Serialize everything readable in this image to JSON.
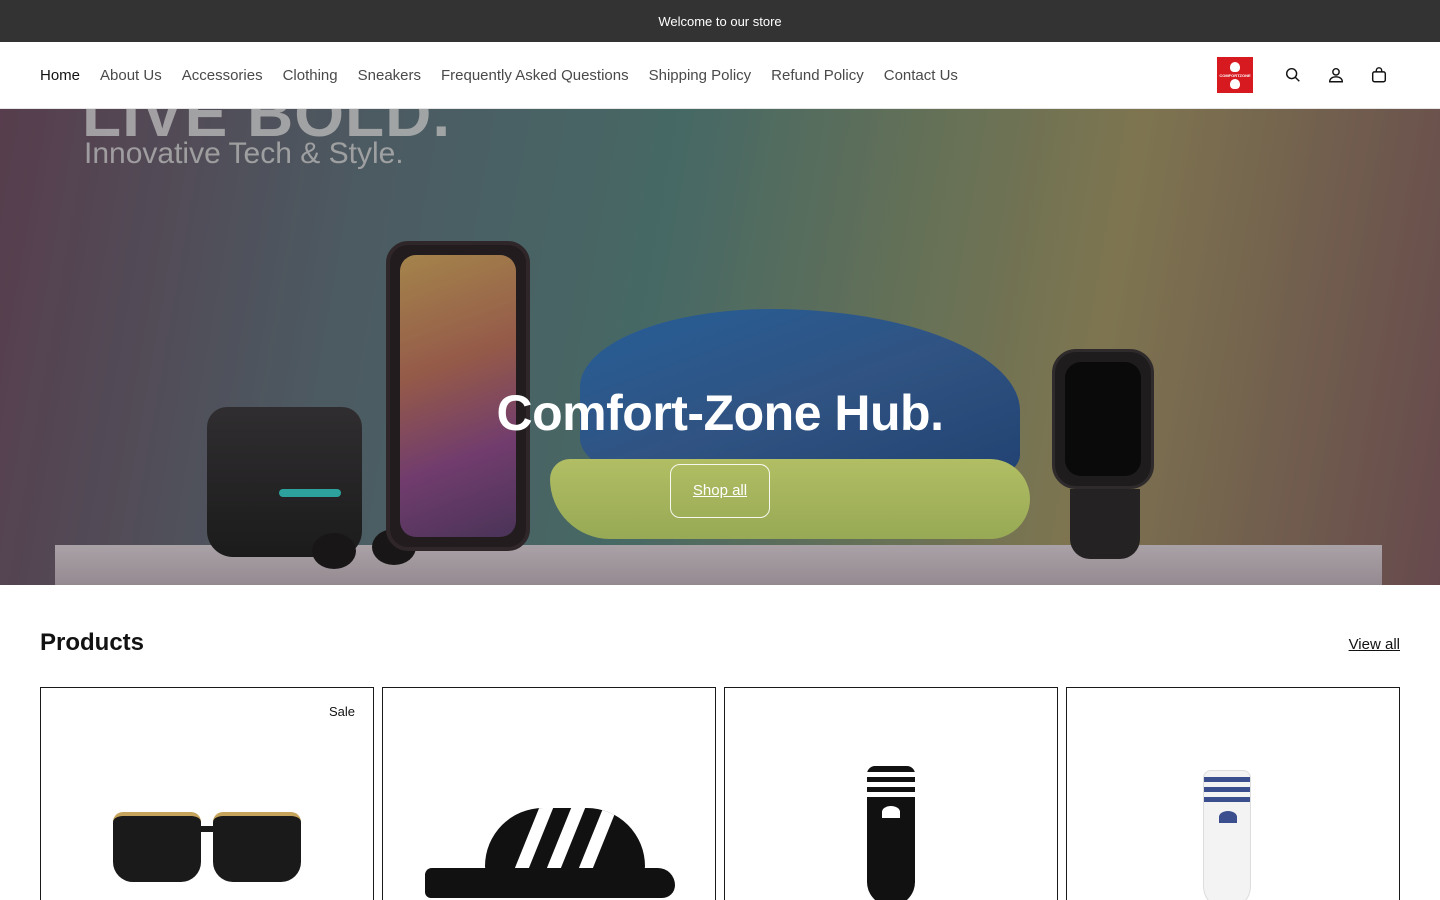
{
  "announcement": {
    "text": "Welcome to our store"
  },
  "nav": {
    "items": [
      {
        "label": "Home"
      },
      {
        "label": "About Us"
      },
      {
        "label": "Accessories"
      },
      {
        "label": "Clothing"
      },
      {
        "label": "Sneakers"
      },
      {
        "label": "Frequently Asked Questions"
      },
      {
        "label": "Shipping Policy"
      },
      {
        "label": "Refund Policy"
      },
      {
        "label": "Contact Us"
      }
    ],
    "active_index": 0
  },
  "header": {
    "logo_text": "COMFORTZONE",
    "icons": [
      "search-icon",
      "account-icon",
      "cart-icon"
    ]
  },
  "hero": {
    "image_tagline_1": "LIVE BOLD.",
    "image_tagline_2": "Innovative Tech & Style.",
    "title": "Comfort-Zone Hub.",
    "button_label": "Shop all"
  },
  "products": {
    "title": "Products",
    "view_all_label": "View all",
    "cards": [
      {
        "badge": "Sale",
        "image": "black sunglasses"
      },
      {
        "badge": "",
        "image": "black slide sandal with white stripes"
      },
      {
        "badge": "",
        "image": "black crew socks with white stripes"
      },
      {
        "badge": "",
        "image": "white crew socks with blue stripes"
      }
    ]
  },
  "colors": {
    "announcement_bg": "#333333",
    "logo_bg": "#d71920",
    "text": "#121212"
  }
}
